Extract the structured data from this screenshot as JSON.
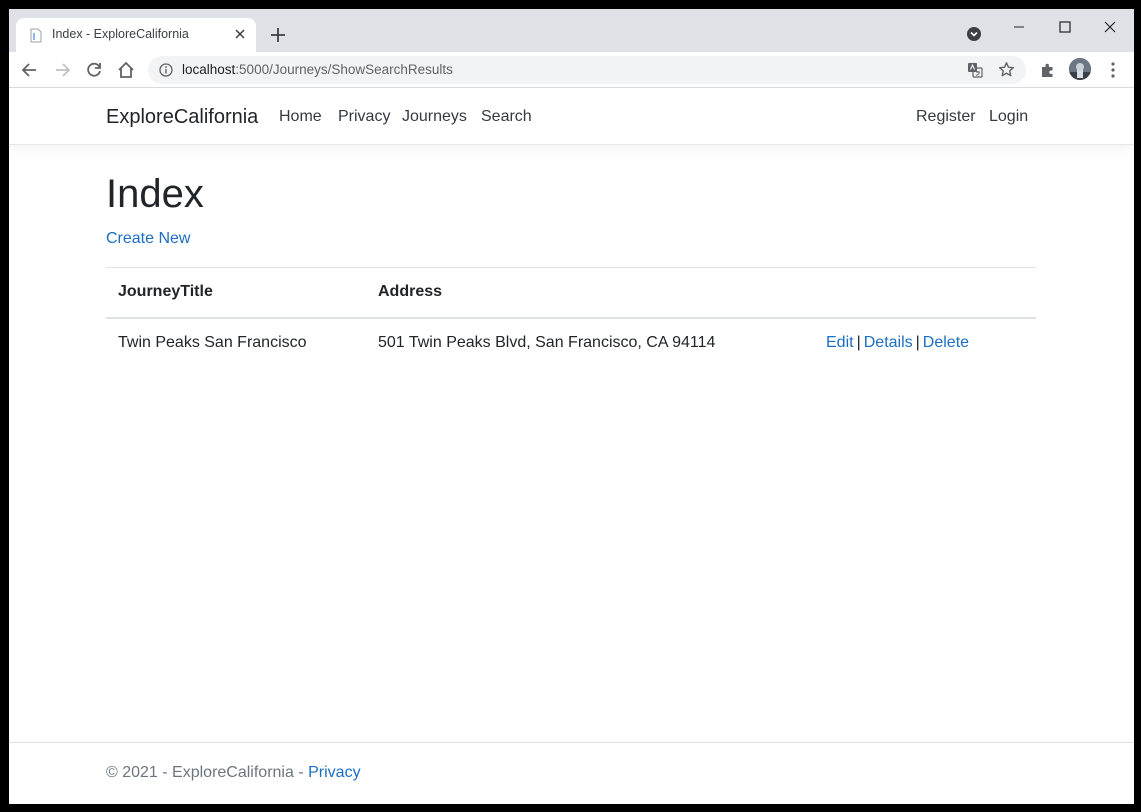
{
  "browser": {
    "tab_title": "Index - ExploreCalifornia",
    "url_host": "localhost",
    "url_path": ":5000/Journeys/ShowSearchResults"
  },
  "nav": {
    "brand": "ExploreCalifornia",
    "links": [
      "Home",
      "Privacy",
      "Journeys",
      "Search"
    ],
    "register": "Register",
    "login": "Login"
  },
  "main": {
    "title": "Index",
    "create_link": "Create New",
    "table": {
      "headers": [
        "JourneyTitle",
        "Address",
        ""
      ],
      "rows": [
        {
          "title": "Twin Peaks San Francisco",
          "address": "501 Twin Peaks Blvd, San Francisco, CA 94114",
          "actions": [
            "Edit",
            "Details",
            "Delete"
          ],
          "separator": "|"
        }
      ]
    }
  },
  "footer": {
    "text": "© 2021 - ExploreCalifornia - ",
    "privacy_link": "Privacy"
  },
  "colors": {
    "link": "#1b6ec2",
    "text": "#212529",
    "chrome_tabstrip": "#dee1e6"
  },
  "icons": [
    "page-favicon-icon",
    "tab-close-icon",
    "new-tab-icon",
    "tab-search-icon",
    "minimize-icon",
    "maximize-icon",
    "window-close-icon",
    "back-icon",
    "forward-icon",
    "reload-icon",
    "home-icon",
    "site-info-icon",
    "translate-icon",
    "bookmark-star-icon",
    "extensions-icon",
    "profile-avatar",
    "more-menu-icon"
  ]
}
